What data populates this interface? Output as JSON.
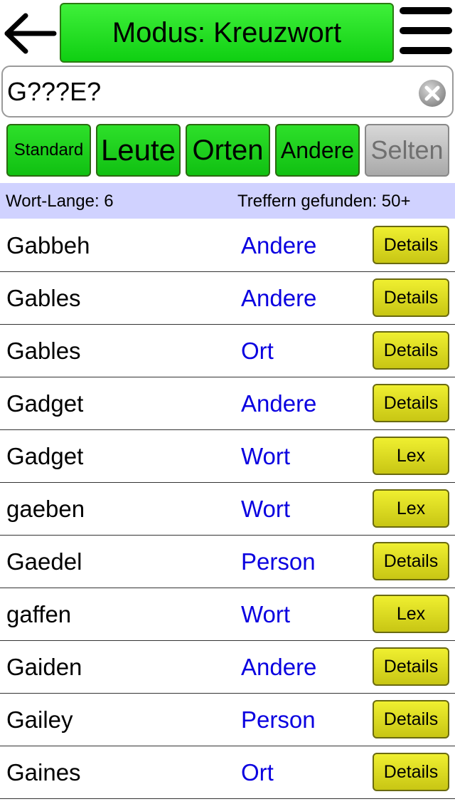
{
  "header": {
    "mode_label": "Modus: Kreuzwort"
  },
  "search": {
    "value": "G???E?"
  },
  "filters": [
    {
      "label": "Standard",
      "active": true
    },
    {
      "label": "Leute",
      "active": true
    },
    {
      "label": "Orten",
      "active": true
    },
    {
      "label": "Andere",
      "active": true
    },
    {
      "label": "Selten",
      "active": false
    }
  ],
  "info": {
    "word_length": "Wort-Lange: 6",
    "hits": "Treffern gefunden: 50+"
  },
  "results": [
    {
      "word": "Gabbeh",
      "category": "Andere",
      "action": "Details"
    },
    {
      "word": "Gables",
      "category": "Andere",
      "action": "Details"
    },
    {
      "word": "Gables",
      "category": "Ort",
      "action": "Details"
    },
    {
      "word": "Gadget",
      "category": "Andere",
      "action": "Details"
    },
    {
      "word": "Gadget",
      "category": "Wort",
      "action": "Lex"
    },
    {
      "word": "gaeben",
      "category": "Wort",
      "action": "Lex"
    },
    {
      "word": "Gaedel",
      "category": "Person",
      "action": "Details"
    },
    {
      "word": "gaffen",
      "category": "Wort",
      "action": "Lex"
    },
    {
      "word": "Gaiden",
      "category": "Andere",
      "action": "Details"
    },
    {
      "word": "Gailey",
      "category": "Person",
      "action": "Details"
    },
    {
      "word": "Gaines",
      "category": "Ort",
      "action": "Details"
    }
  ]
}
